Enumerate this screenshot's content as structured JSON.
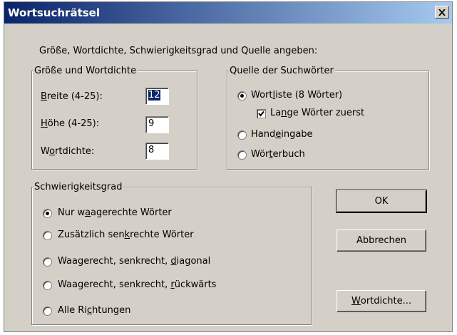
{
  "window": {
    "title": "Wortsuchrätsel"
  },
  "instruction": "Größe, Wortdichte, Schwierigkeitsgrad und Quelle angeben:",
  "size_group": {
    "legend": "Größe und Wortdichte",
    "width": {
      "pre": "",
      "key": "B",
      "post": "reite (4-25):",
      "value": "12"
    },
    "height": {
      "pre": "",
      "key": "H",
      "post": "öhe (4-25):",
      "value": "9"
    },
    "density": {
      "pre": "W",
      "key": "o",
      "post": "rtdichte:",
      "value": "8"
    }
  },
  "source_group": {
    "legend": "Quelle der Suchwörter",
    "wordlist": {
      "pre": "Wort",
      "key": "l",
      "post": "iste (8 Wörter)"
    },
    "long_words_first": {
      "pre": "La",
      "key": "n",
      "post": "ge Wörter zuerst"
    },
    "manual": {
      "pre": "Hand",
      "key": "e",
      "post": "ingabe"
    },
    "dictionary": {
      "pre": "Wör",
      "key": "t",
      "post": "erbuch"
    }
  },
  "difficulty_group": {
    "legend": "Schwierigkeitsgrad",
    "opt1": {
      "pre": "Nur w",
      "key": "a",
      "post": "agerechte Wörter"
    },
    "opt2": {
      "pre": "Zusätzlich sen",
      "key": "k",
      "post": "rechte Wörter"
    },
    "opt3": {
      "pre": "Waagerecht, senkrecht, ",
      "key": "d",
      "post": "iagonal"
    },
    "opt4": {
      "pre": "Waagerecht, senkrecht, ",
      "key": "r",
      "post": "ückwärts"
    },
    "opt5": {
      "pre": "Alle Ri",
      "key": "c",
      "post": "htungen"
    }
  },
  "buttons": {
    "ok": "OK",
    "cancel": "Abbrechen",
    "density": {
      "pre": "",
      "key": "W",
      "post": "ortdichte..."
    }
  }
}
